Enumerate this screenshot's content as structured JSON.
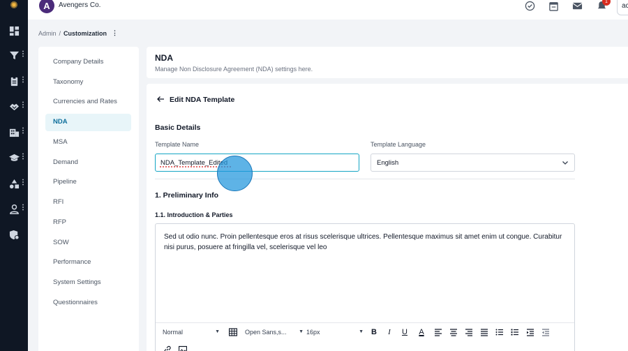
{
  "app": {
    "org_name": "Avengers Co.",
    "org_initial": "A",
    "user_initials": "ac",
    "notification_count": "1"
  },
  "breadcrumb": {
    "root": "Admin",
    "separator": "/",
    "current": "Customization",
    "menu_icon": "kebab-icon"
  },
  "rail": {
    "icons": [
      "dashboard-icon",
      "filter-icon",
      "clipboard-icon",
      "handshake-icon",
      "building-icon",
      "graduation-cap-icon",
      "shapes-icon",
      "user-icon",
      "shield-gear-icon"
    ]
  },
  "settings_menu": {
    "items": [
      {
        "label": "Company Details"
      },
      {
        "label": "Taxonomy"
      },
      {
        "label": "Currencies and Rates"
      },
      {
        "label": "NDA"
      },
      {
        "label": "MSA"
      },
      {
        "label": "Demand"
      },
      {
        "label": "Pipeline"
      },
      {
        "label": "RFI"
      },
      {
        "label": "RFP"
      },
      {
        "label": "SOW"
      },
      {
        "label": "Performance"
      },
      {
        "label": "System Settings"
      },
      {
        "label": "Questionnaires"
      }
    ],
    "active": "NDA"
  },
  "page_header": {
    "title": "NDA",
    "subtitle": "Manage Non Disclosure Agreement (NDA) settings here."
  },
  "form": {
    "title": "Edit NDA Template",
    "basic_details": "Basic Details",
    "template_name_label": "Template Name",
    "template_name_value": "NDA_Template_Edited",
    "template_language_label": "Template Language",
    "template_language_value": "English",
    "section_heading": "1. Preliminary Info",
    "subsection_heading": "1.1. Introduction & Parties",
    "editor_text": "Sed ut odio nunc. Proin pellentesque eros at risus scelerisque ultrices. Pellentesque maximus sit amet enim ut congue. Curabitur nisi purus, posuere at fringilla vel, scelerisque vel leo"
  },
  "editor_toolbar": {
    "paragraph_style": "Normal",
    "font_family": "Open Sans,s...",
    "font_size": "16px",
    "bold": "B",
    "italic": "I",
    "underline": "U",
    "font_color": "A"
  },
  "colors": {
    "accent": "#14a5c4",
    "active_menu_bg": "#e8f5f9",
    "rail_bg": "#0f1724",
    "click_indicator": "#2096dc"
  }
}
